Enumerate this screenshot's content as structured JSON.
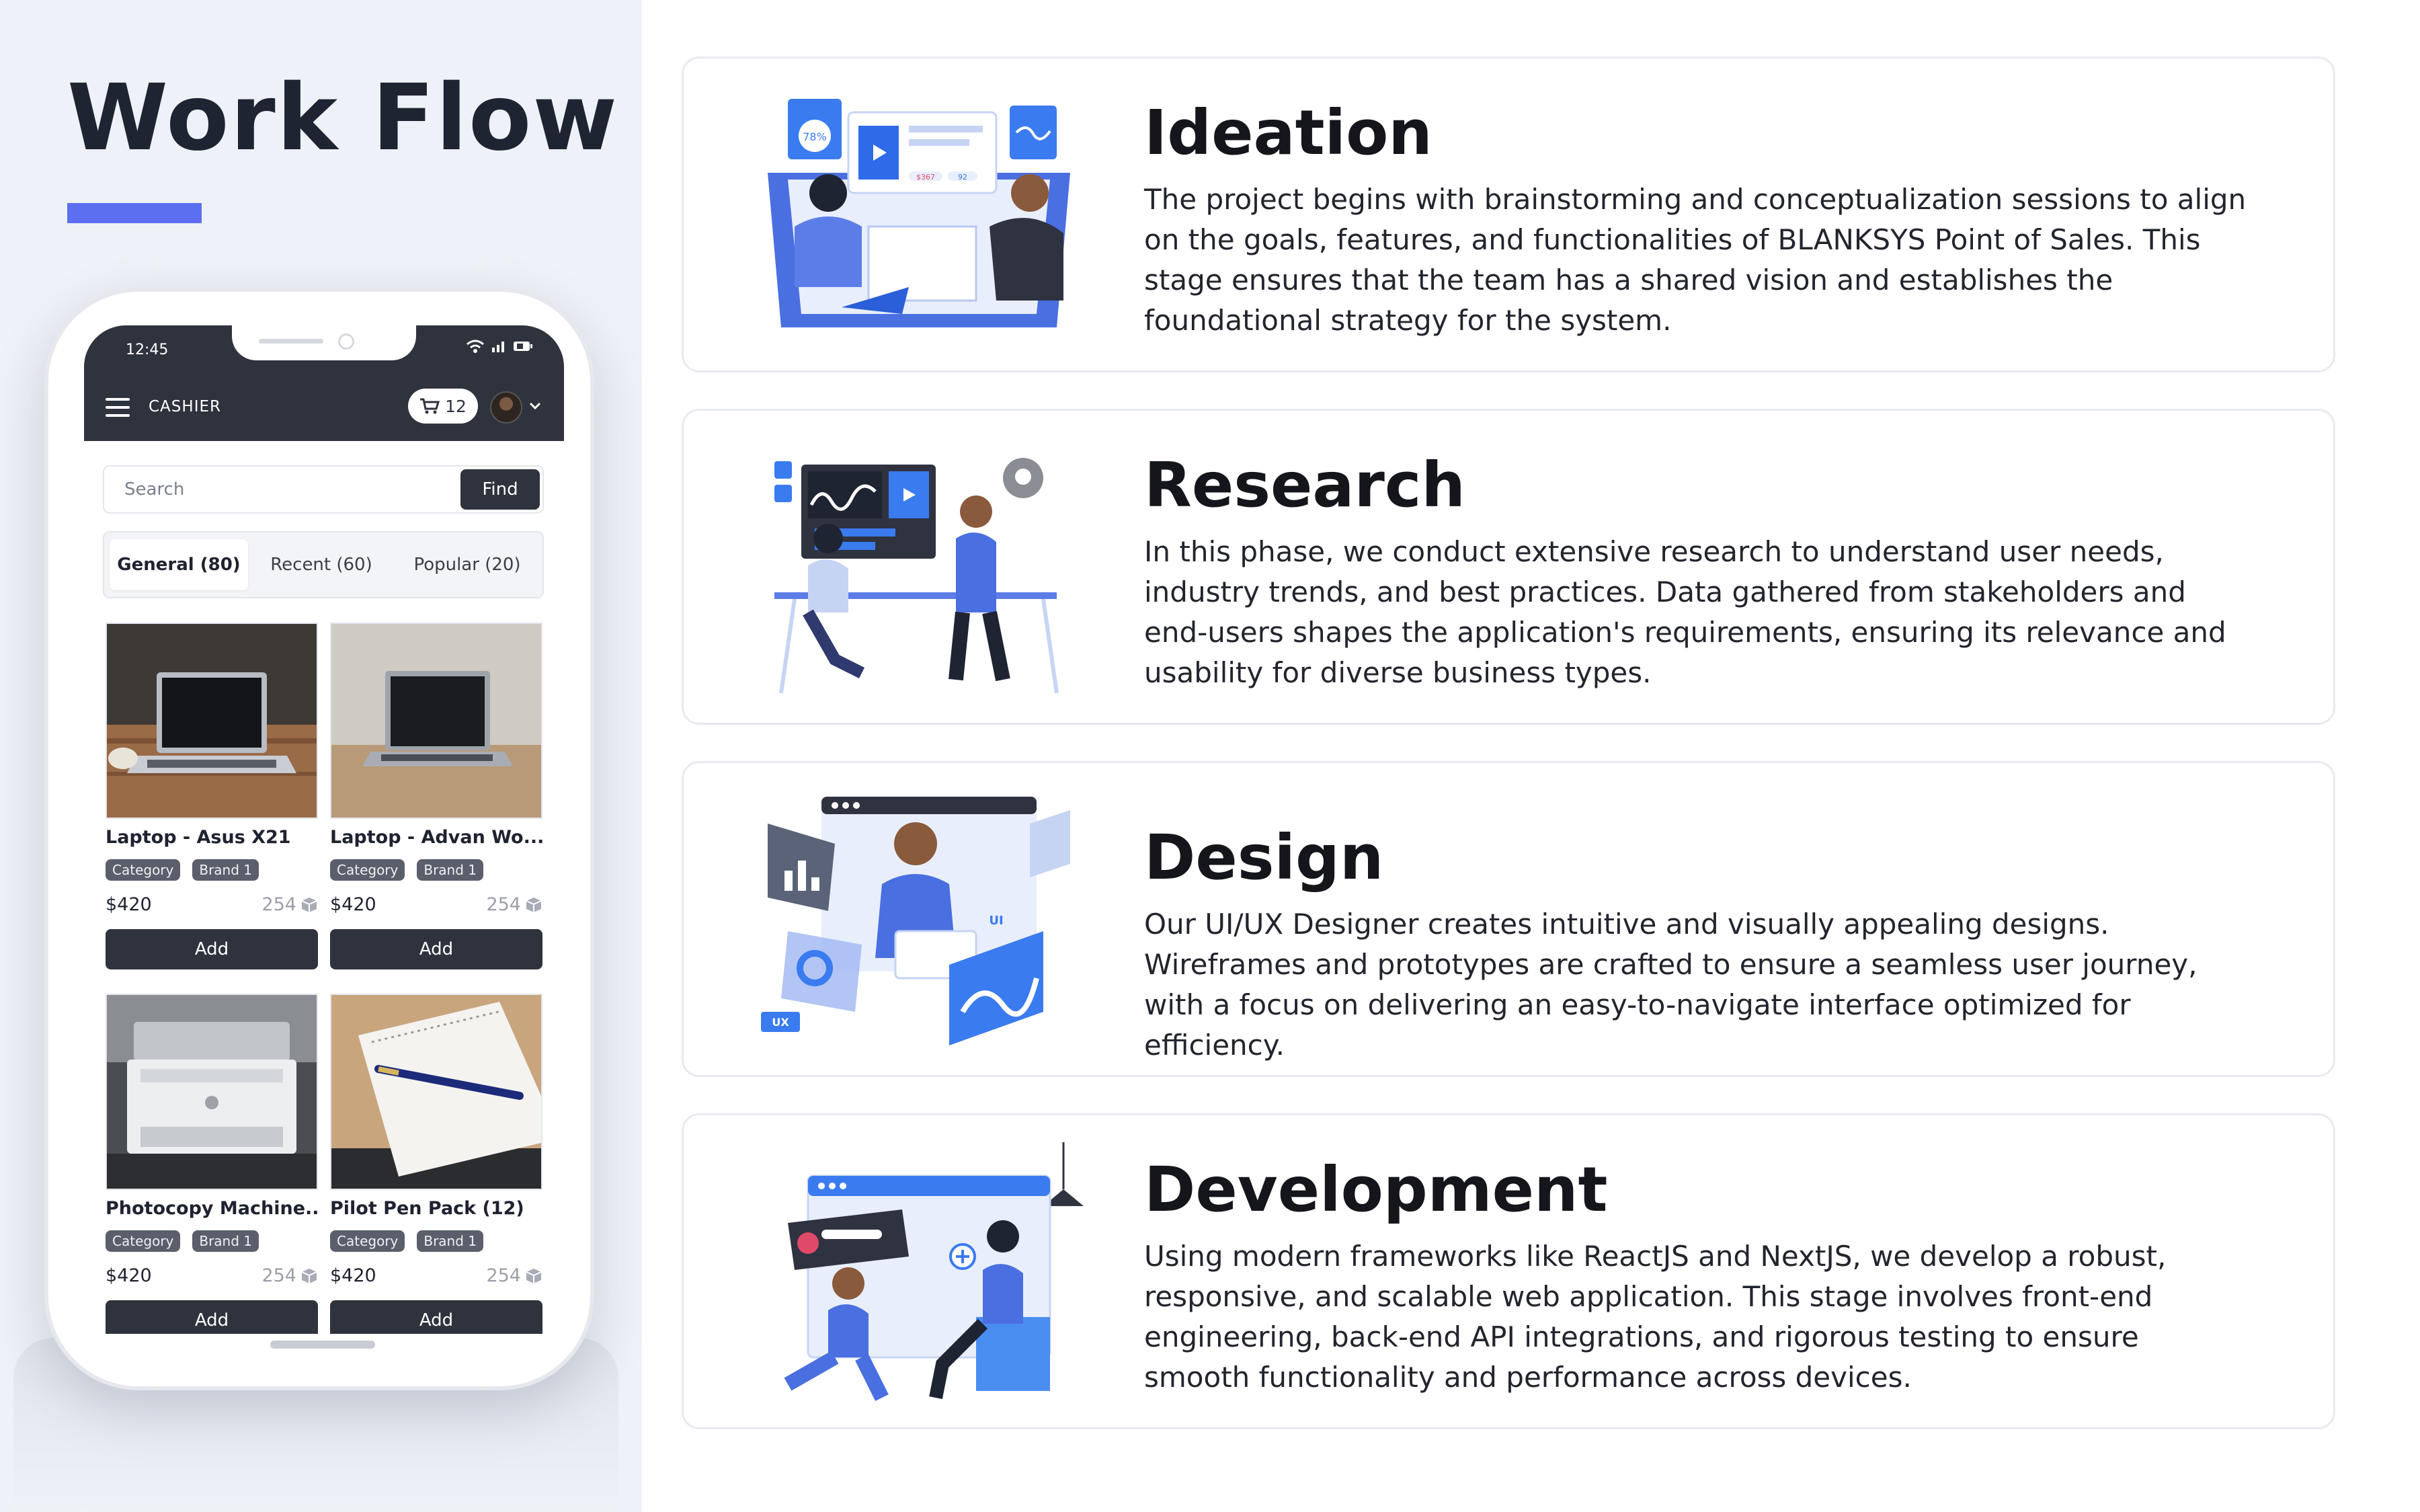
{
  "page": {
    "title": "Work Flow",
    "accent_color": "#5c6ff0"
  },
  "phone": {
    "status_time": "12:45",
    "header": {
      "title": "CASHIER",
      "cart_count": "12"
    },
    "search": {
      "placeholder": "Search",
      "button_label": "Find"
    },
    "tabs": [
      {
        "label": "General (80)",
        "active": true
      },
      {
        "label": "Recent (60)",
        "active": false
      },
      {
        "label": "Popular (20)",
        "active": false
      }
    ],
    "products": [
      {
        "name": "Laptop - Asus X21",
        "category": "Category",
        "brand": "Brand 1",
        "price": "$420",
        "stock": "254",
        "add_label": "Add"
      },
      {
        "name": "Laptop - Advan Wo...",
        "category": "Category",
        "brand": "Brand 1",
        "price": "$420",
        "stock": "254",
        "add_label": "Add"
      },
      {
        "name": "Photocopy Machine..",
        "category": "Category",
        "brand": "Brand 1",
        "price": "$420",
        "stock": "254",
        "add_label": "Add"
      },
      {
        "name": "Pilot Pen Pack (12)",
        "category": "Category",
        "brand": "Brand 1",
        "price": "$420",
        "stock": "254",
        "add_label": "Add"
      }
    ]
  },
  "steps": [
    {
      "title": "Ideation",
      "description": "The project begins with brainstorming and conceptualization sessions to align on the goals, features, and functionalities of BLANKSYS Point of Sales. This stage ensures that the team has a shared vision and establishes the foundational strategy for the system.",
      "illustration": "brainstorming-team-illustration",
      "illustration_labels": {
        "pie_label": "78%",
        "chip_a": "$367",
        "chip_b": "92"
      }
    },
    {
      "title": "Research",
      "description": "In this phase, we conduct extensive research to understand user needs, industry trends, and best practices. Data gathered from stakeholders and end-users shapes the application's requirements, ensuring its relevance and usability for diverse business types.",
      "illustration": "research-analytics-illustration"
    },
    {
      "title": "Design",
      "description": "Our UI/UX Designer creates intuitive and visually appealing designs. Wireframes and prototypes are crafted to ensure a seamless user journey, with a focus on delivering an easy-to-navigate interface optimized for efficiency.",
      "illustration": "ui-ux-design-illustration",
      "illustration_labels": {
        "ui_tag": "UI",
        "ux_tag": "UX"
      }
    },
    {
      "title": "Development",
      "description": "Using modern frameworks like ReactJS and NextJS, we develop a robust, responsive, and scalable web application. This stage involves front-end engineering, back-end API integrations, and rigorous testing to ensure smooth functionality and performance across devices.",
      "illustration": "web-development-illustration"
    }
  ]
}
